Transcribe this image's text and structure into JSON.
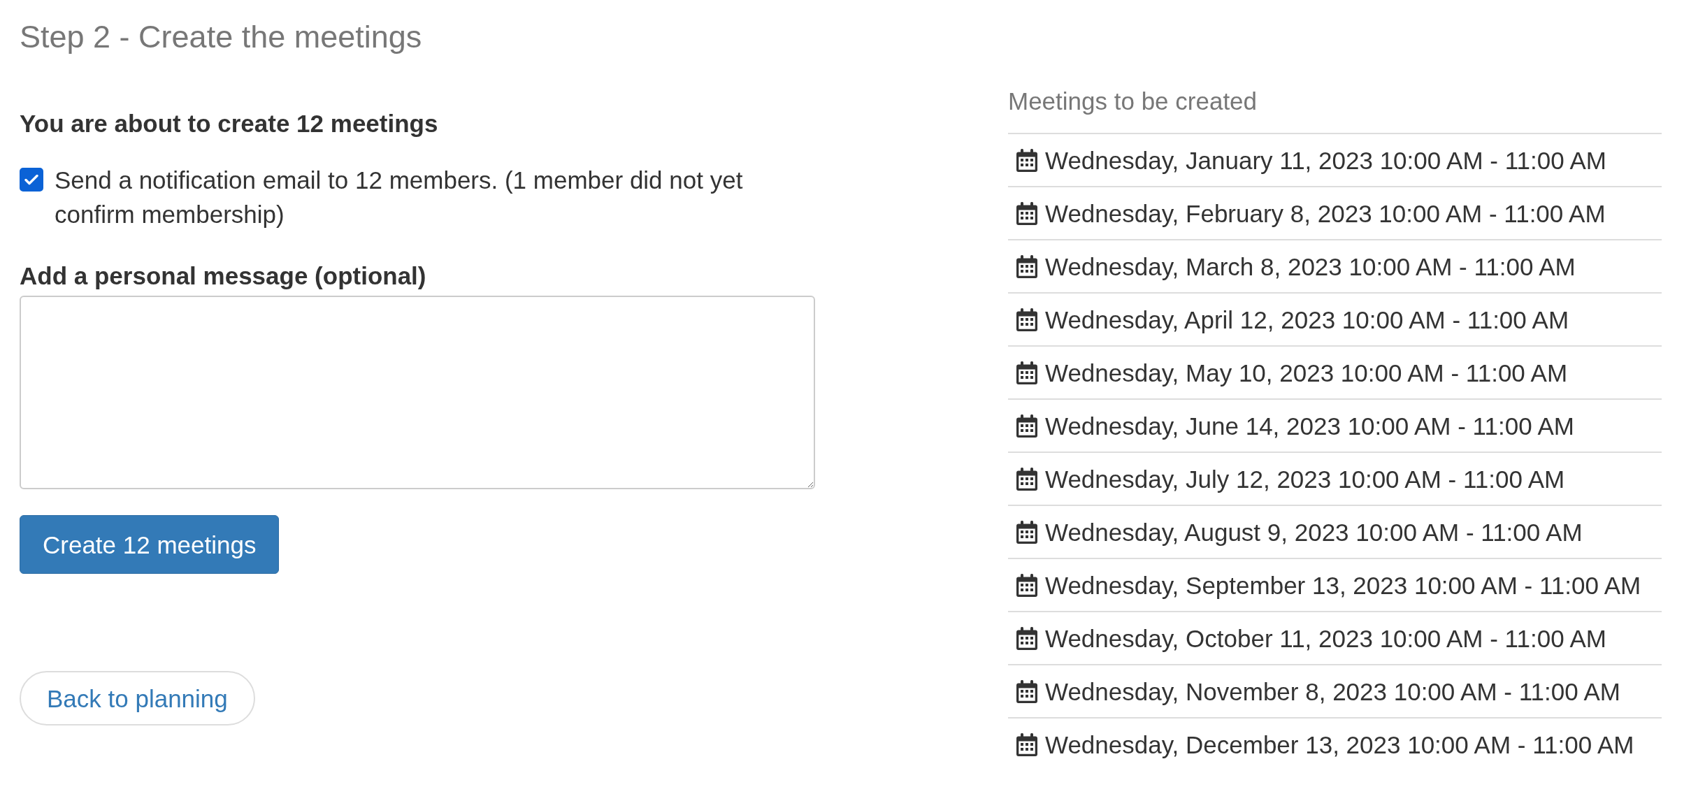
{
  "page_title": "Step 2 - Create the meetings",
  "summary": {
    "heading": "You are about to create 12 meetings"
  },
  "notification": {
    "label": "Send a notification email to 12 members. (1 member did not yet confirm membership)",
    "checked": true
  },
  "message": {
    "label": "Add a personal message (optional)"
  },
  "create_button": "Create 12 meetings",
  "back_button": "Back to planning",
  "meetings": {
    "title": "Meetings to be created",
    "items": [
      "Wednesday, January 11, 2023 10:00 AM - 11:00 AM",
      "Wednesday, February 8, 2023 10:00 AM - 11:00 AM",
      "Wednesday, March 8, 2023 10:00 AM - 11:00 AM",
      "Wednesday, April 12, 2023 10:00 AM - 11:00 AM",
      "Wednesday, May 10, 2023 10:00 AM - 11:00 AM",
      "Wednesday, June 14, 2023 10:00 AM - 11:00 AM",
      "Wednesday, July 12, 2023 10:00 AM - 11:00 AM",
      "Wednesday, August 9, 2023 10:00 AM - 11:00 AM",
      "Wednesday, September 13, 2023 10:00 AM - 11:00 AM",
      "Wednesday, October 11, 2023 10:00 AM - 11:00 AM",
      "Wednesday, November 8, 2023 10:00 AM - 11:00 AM",
      "Wednesday, December 13, 2023 10:00 AM - 11:00 AM"
    ]
  }
}
